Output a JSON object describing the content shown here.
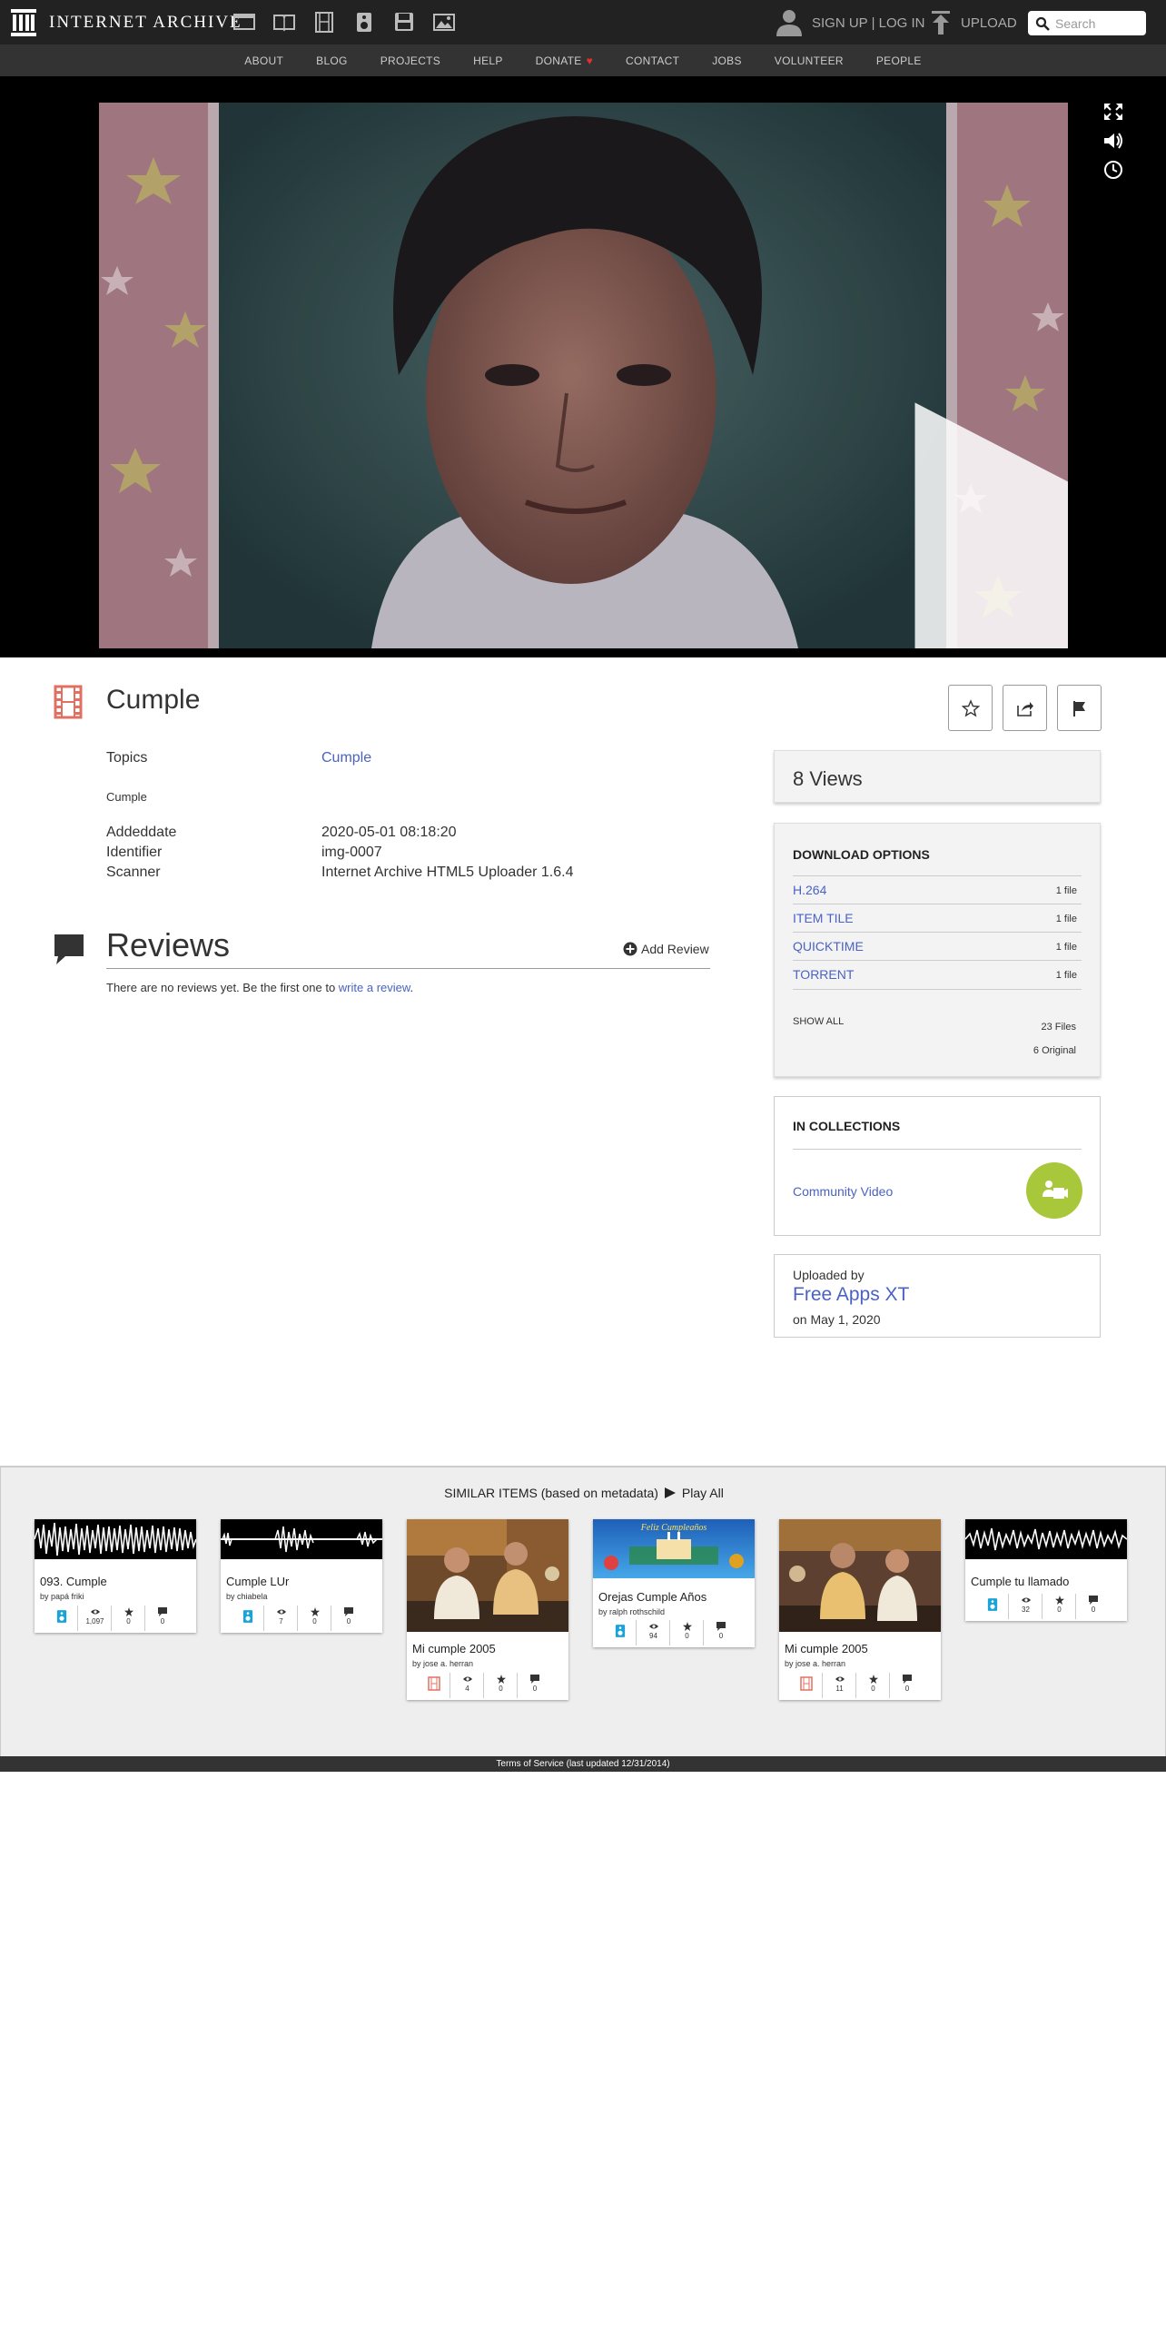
{
  "header": {
    "logo_text": "INTERNET ARCHIVE",
    "sign_up": "SIGN UP",
    "separator": " | ",
    "log_in": "LOG IN",
    "upload": "UPLOAD",
    "search_placeholder": "Search"
  },
  "nav": [
    "ABOUT",
    "BLOG",
    "PROJECTS",
    "HELP",
    "DONATE",
    "CONTACT",
    "JOBS",
    "VOLUNTEER",
    "PEOPLE"
  ],
  "item": {
    "title": "Cumple",
    "media_icon": "film-icon"
  },
  "metadata": {
    "topics_key": "Topics",
    "topics_val": "Cumple",
    "description": "Cumple",
    "addeddate_key": "Addeddate",
    "addeddate_val": "2020-05-01 08:18:20",
    "identifier_key": "Identifier",
    "identifier_val": "img-0007",
    "scanner_key": "Scanner",
    "scanner_val": "Internet Archive HTML5 Uploader 1.6.4"
  },
  "reviews": {
    "title": "Reviews",
    "add_review": "Add Review",
    "empty_text": "There are no reviews yet. Be the first one to ",
    "write_link": "write a review",
    "end": "."
  },
  "sidebar": {
    "views": "8 Views",
    "download_heading": "DOWNLOAD OPTIONS",
    "downloads": [
      {
        "name": "H.264",
        "count": "1 file"
      },
      {
        "name": "ITEM TILE",
        "count": "1 file"
      },
      {
        "name": "QUICKTIME",
        "count": "1 file"
      },
      {
        "name": "TORRENT",
        "count": "1 file"
      }
    ],
    "show_all": "SHOW ALL",
    "files": "23 Files",
    "original": "6 Original",
    "collections_heading": "IN COLLECTIONS",
    "collection_name": "Community Video",
    "uploaded_by": "Uploaded by",
    "uploader": "Free Apps XT",
    "upload_date": "on May 1, 2020"
  },
  "similar": {
    "heading": "SIMILAR ITEMS (based on metadata)",
    "play_all": "Play All",
    "tiles": [
      {
        "title": "093. Cumple",
        "by": "by papá friki",
        "type": "audio",
        "views": "1,097",
        "favs": "0",
        "reviews": "0"
      },
      {
        "title": "Cumple LUr",
        "by": "by chiabela",
        "type": "audio",
        "views": "7",
        "favs": "0",
        "reviews": "0"
      },
      {
        "title": "Mi cumple 2005",
        "by": "by jose a. herran",
        "type": "movie",
        "views": "4",
        "favs": "0",
        "reviews": "0"
      },
      {
        "title": "Orejas Cumple Años",
        "by": "by ralph rothschild",
        "type": "audio",
        "views": "94",
        "favs": "0",
        "reviews": "0",
        "thumb_text": "Feliz Cumpleaños"
      },
      {
        "title": "Mi cumple 2005",
        "by": "by jose a. herran",
        "type": "movie",
        "views": "11",
        "favs": "0",
        "reviews": "0"
      },
      {
        "title": "Cumple tu llamado",
        "by": "",
        "type": "audio",
        "views": "32",
        "favs": "0",
        "reviews": "0"
      }
    ]
  },
  "footer": {
    "text": "Terms of Service (last updated 12/31/2014)"
  },
  "colors": {
    "link": "#4a62c4",
    "topbar": "#222222",
    "navbar": "#333333",
    "film_icon": "#e07060",
    "collection_badge": "#a9c73a",
    "audio_icon": "#1aa3d9"
  }
}
